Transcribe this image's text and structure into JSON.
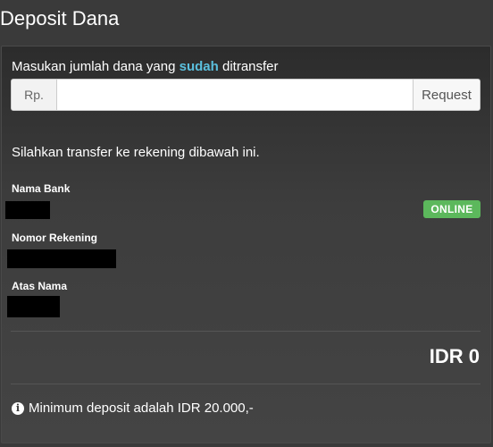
{
  "header": {
    "title": "Deposit Dana"
  },
  "deposit_form": {
    "prompt_before": "Masukan jumlah dana yang ",
    "prompt_highlight": "sudah",
    "prompt_after": " ditransfer",
    "currency_prefix": "Rp.",
    "amount_value": "",
    "amount_placeholder": "",
    "request_label": "Request"
  },
  "transfer": {
    "instruction": "Silahkan transfer ke rekening dibawah ini.",
    "bank_label": "Nama Bank",
    "account_number_label": "Nomor Rekening",
    "account_name_label": "Atas Nama",
    "status": "ONLINE"
  },
  "summary": {
    "total": "IDR 0",
    "min_deposit_note": "Minimum deposit adalah IDR 20.000,-"
  },
  "icons": {
    "info": "info-circle-icon"
  },
  "colors": {
    "highlight": "#5bc0de",
    "online_badge": "#5cb85c",
    "panel_bg": "#3a3a3a"
  }
}
